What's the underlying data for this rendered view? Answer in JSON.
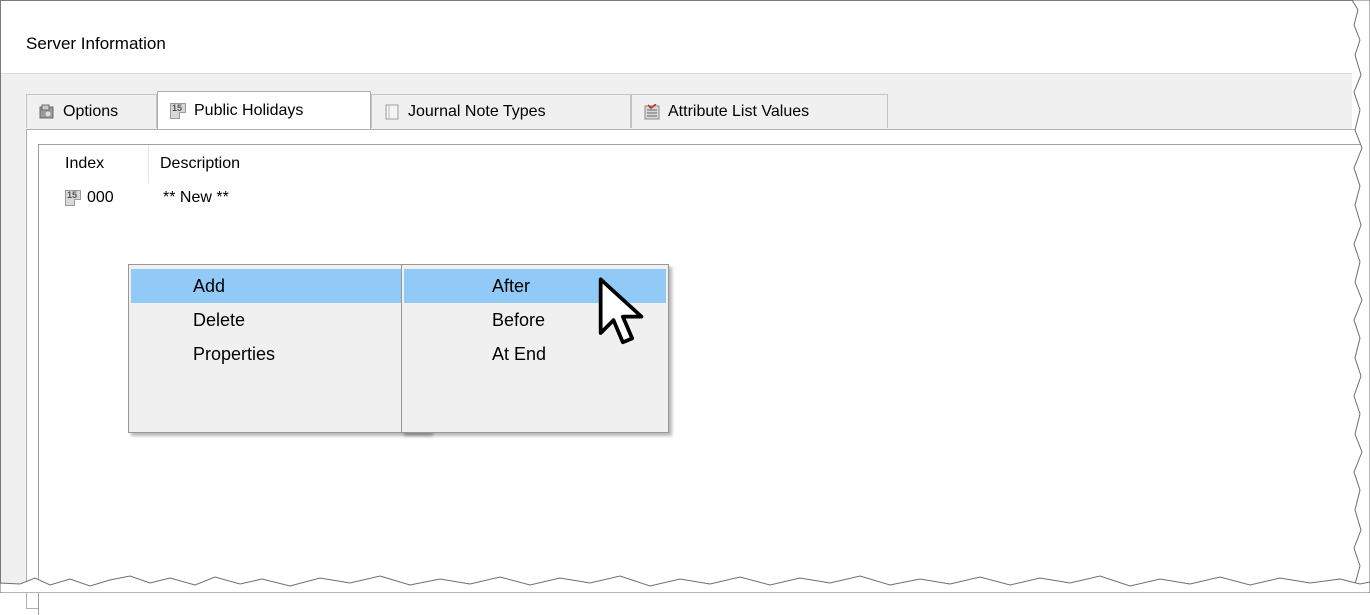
{
  "window": {
    "title": "Server Information"
  },
  "tabs": [
    {
      "label": "Options",
      "icon": "options-icon"
    },
    {
      "label": "Public Holidays",
      "icon": "calendar-icon"
    },
    {
      "label": "Journal Note Types",
      "icon": "journal-icon"
    },
    {
      "label": "Attribute List Values",
      "icon": "attribute-list-icon"
    }
  ],
  "active_tab": "Public Holidays",
  "list": {
    "columns": [
      "Index",
      "Description"
    ],
    "rows": [
      {
        "index": "000",
        "description": "** New **"
      }
    ]
  },
  "context_menu": {
    "items": [
      {
        "label": "Add",
        "submenu_arrow": ">"
      },
      {
        "label": "Delete"
      },
      {
        "label": "Properties"
      }
    ],
    "highlighted": "Add"
  },
  "submenu": {
    "items": [
      {
        "label": "After"
      },
      {
        "label": "Before"
      },
      {
        "label": "At End"
      }
    ],
    "highlighted": "After"
  },
  "colors": {
    "highlight": "#91c9f7",
    "menu_bg": "#f0f0f0"
  }
}
